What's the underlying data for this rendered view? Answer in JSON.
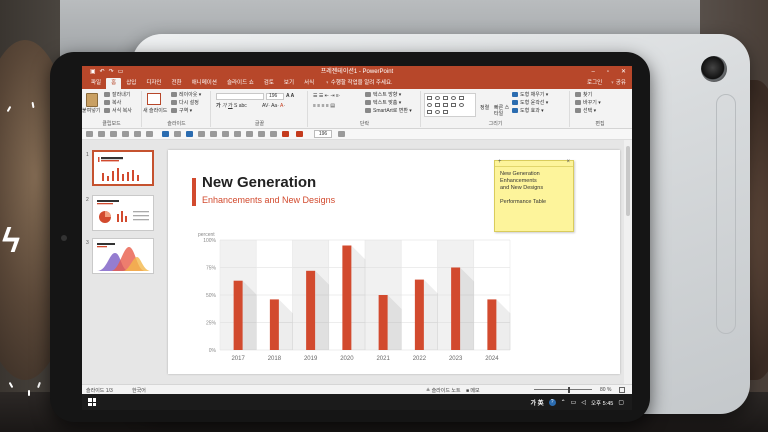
{
  "window": {
    "title": "프레젠테이션1 - PowerPoint",
    "controls": [
      "–",
      "▫",
      "✕"
    ],
    "qat_icons": [
      "save-icon",
      "undo-icon",
      "redo-icon",
      "start-slideshow-icon"
    ]
  },
  "tabs": [
    {
      "label": "파일",
      "active": false
    },
    {
      "label": "홈",
      "active": true
    },
    {
      "label": "삽입",
      "active": false
    },
    {
      "label": "디자인",
      "active": false
    },
    {
      "label": "전환",
      "active": false
    },
    {
      "label": "애니메이션",
      "active": false
    },
    {
      "label": "슬라이드 쇼",
      "active": false
    },
    {
      "label": "검토",
      "active": false
    },
    {
      "label": "보기",
      "active": false
    },
    {
      "label": "서식",
      "active": false
    }
  ],
  "tell_me": "♀ 수행할 작업을 알려 주세요.",
  "tabs_right": {
    "login": "로그인",
    "share": "♀ 공유"
  },
  "ribbon": {
    "clipboard": {
      "paste": "붙여넣기",
      "cut": "잘라내기",
      "copy": "복사",
      "format_painter": "서식 복사",
      "label": "클립보드"
    },
    "slides": {
      "new_slide": "새 슬라이드",
      "layout": "레이아웃 ▾",
      "reset": "다시 설정",
      "section": "구역 ▾",
      "label": "슬라이드"
    },
    "font": {
      "font_size": "196",
      "label": "글꼴"
    },
    "paragraph": {
      "text_direction": "텍스트 방향 ▾",
      "align_text": "텍스트 맞춤 ▾",
      "smartart": "SmartArt로 변환 ▾",
      "label": "단락"
    },
    "drawing": {
      "arrange": "정렬",
      "quick_styles": "빠른 스타일",
      "shape_fill": "도형 채우기 ▾",
      "shape_outline": "도형 윤곽선 ▾",
      "shape_effects": "도형 효과 ▾",
      "label": "그리기"
    },
    "editing": {
      "find": "찾기",
      "replace": "바꾸기 ▾",
      "select": "선택 ▾",
      "label": "편집"
    }
  },
  "quick_toolbar": {
    "zoom_value": "196"
  },
  "thumbnails": [
    {
      "num": "1",
      "selected": true
    },
    {
      "num": "2",
      "selected": false
    },
    {
      "num": "3",
      "selected": false
    }
  ],
  "slide": {
    "title": "New Generation",
    "subtitle": "Enhancements and New Designs"
  },
  "sticky_note": {
    "text": "New Generation\nEnhancements\nand New Designs\n\nPerformance Table"
  },
  "chart_data": {
    "type": "bar",
    "ylabel": "percent",
    "ylim": [
      0,
      100
    ],
    "y_ticks": [
      "0%",
      "25%",
      "50%",
      "75%",
      "100%"
    ],
    "categories": [
      "2017",
      "2018",
      "2019",
      "2020",
      "2021",
      "2022",
      "2023",
      "2024"
    ],
    "values": [
      63,
      46,
      72,
      95,
      50,
      64,
      75,
      46
    ],
    "bar_color": "#d24a2e",
    "grid": true
  },
  "status": {
    "slide_counter": "슬라이드 1/3",
    "language": "한국어",
    "notes": "≜ 슬라이드 노트",
    "comments": "■ 메모",
    "zoom": "80 %"
  },
  "taskbar": {
    "ime_mode": "가 英",
    "time": "오후 5:45"
  },
  "colors": {
    "accent": "#b7472a",
    "slide_red": "#d24a2e",
    "sticky": "#fdf49b"
  }
}
